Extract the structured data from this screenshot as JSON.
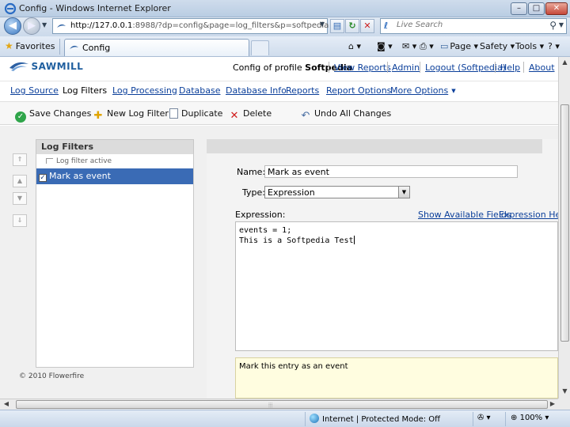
{
  "window": {
    "title": "Config - Windows Internet Explorer",
    "minimize": "–",
    "maximize": "□",
    "close": "✕"
  },
  "address": {
    "url_host": "http://127.0.0.1",
    "url_rest": ":8988/?dp=config&page=log_filters&p=softpedia",
    "search_placeholder": "Live Search"
  },
  "tabs": {
    "favorites": "Favorites",
    "active_tab": "Config"
  },
  "commands": {
    "page": "Page",
    "safety": "Safety",
    "tools": "Tools",
    "help_icon": "?"
  },
  "header": {
    "logo": "SAWMILL",
    "profile_prefix": "Config of profile ",
    "profile_name": "Softpedia",
    "links": [
      "View Reports",
      "Admin",
      "Logout (Softpedia)",
      "Help",
      "About"
    ]
  },
  "menu": {
    "items": [
      "Log Source",
      "Log Filters",
      "Log Processing",
      "Database",
      "Database Info",
      "Reports",
      "Report Options"
    ],
    "more": "More Options",
    "active": "Log Filters"
  },
  "toolbar": {
    "save": "Save Changes",
    "new_filter": "New Log Filter",
    "duplicate": "Duplicate",
    "delete": "Delete",
    "undo": "Undo All Changes"
  },
  "log_filters": {
    "title": "Log Filters",
    "note": "Log filter active",
    "selected_item": "Mark as event",
    "checked": true
  },
  "editor": {
    "name_label": "Name:",
    "name_value": "Mark as event",
    "type_label": "Type:",
    "type_value": "Expression",
    "expression_label": "Expression:",
    "show_fields": "Show Available Fields",
    "expression_help": "Expression Help",
    "expression_lines": [
      "events = 1;",
      "This is a Softpedia Test"
    ],
    "comment": "Mark this entry as an event"
  },
  "footer": {
    "copyright": "© 2010 Flowerfire"
  },
  "status": {
    "zone": "Internet | Protected Mode: Off",
    "zoom": "100%"
  }
}
